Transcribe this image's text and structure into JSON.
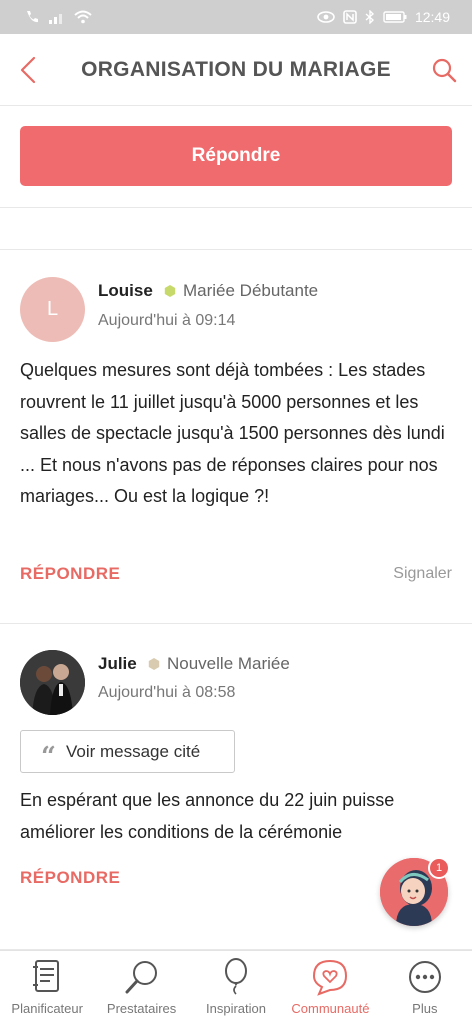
{
  "status_bar": {
    "time": "12:49"
  },
  "header": {
    "title": "ORGANISATION DU MARIAGE"
  },
  "reply_bar": {
    "button_label": "Répondre"
  },
  "posts": [
    {
      "avatar_letter": "L",
      "author": "Louise",
      "role": "Mariée Débutante",
      "role_color": "#c8d96b",
      "time": "Aujourd'hui à 09:14",
      "body": "Quelques mesures sont déjà tombées : Les stades rouvrent le 11 juillet jusqu'à 5000 personnes et les salles de spectacle jusqu'à 1500 personnes dès lundi ... Et nous n'avons pas de réponses claires pour nos mariages... Ou est la logique ?!",
      "reply_label": "RÉPONDRE",
      "report_label": "Signaler"
    },
    {
      "author": "Julie",
      "role": "Nouvelle Mariée",
      "role_color": "#d8cbb0",
      "time": "Aujourd'hui à 08:58",
      "quote_label": "Voir message cité",
      "body": "En espérant que les annonce du 22 juin puisse améliorer les conditions de la cérémonie",
      "reply_label": "RÉPONDRE"
    }
  ],
  "fab": {
    "badge": "1"
  },
  "bottom_nav": [
    {
      "label": "Planificateur",
      "icon": "planner-icon"
    },
    {
      "label": "Prestataires",
      "icon": "search-vendors-icon"
    },
    {
      "label": "Inspiration",
      "icon": "balloon-icon"
    },
    {
      "label": "Communauté",
      "icon": "community-icon",
      "active": true
    },
    {
      "label": "Plus",
      "icon": "more-icon"
    }
  ],
  "colors": {
    "accent": "#f06b6e",
    "nav_active": "#e86a64"
  }
}
